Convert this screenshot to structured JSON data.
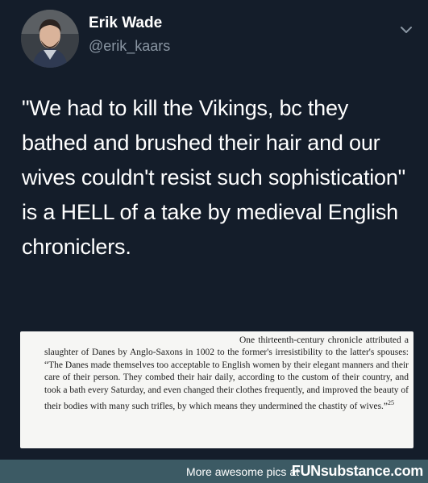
{
  "tweet": {
    "author_name": "Erik Wade",
    "handle": "@erik_kaars",
    "text": "\"We had to kill the Vikings, bc they bathed and brushed their hair and our wives couldn't resist such sophistication\" is a HELL of a take by medieval English chroniclers.",
    "menu_icon": "chevron-down-icon"
  },
  "quote": {
    "text": "One thirteenth-century chronicle attributed a slaughter of Danes by Anglo-Saxons in 1002 to the former's irresistibility to the latter's spouses: “The Danes made themselves too acceptable to English women by their elegant manners and their care of their person. They combed their hair daily, according to the custom of their country, and took a bath every Saturday, and even changed their clothes frequently, and improved the beauty of their bodies with many such trifles, by which means they undermined the chastity of wives.”",
    "footnote": "25"
  },
  "footer": {
    "left_text": "More awesome pics at",
    "brand_prefix": "FUN",
    "brand_suffix": "substance",
    "brand_tld": ".com"
  },
  "colors": {
    "background": "#15202b",
    "footer": "#3c5a64",
    "muted": "#8a96a3"
  }
}
